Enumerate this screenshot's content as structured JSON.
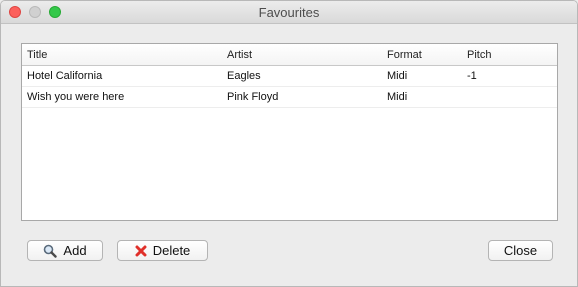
{
  "window": {
    "title": "Favourites"
  },
  "table": {
    "columns": [
      "Title",
      "Artist",
      "Format",
      "Pitch"
    ],
    "rows": [
      {
        "title": "Hotel California",
        "artist": "Eagles",
        "format": "Midi",
        "pitch": "-1"
      },
      {
        "title": "Wish you were here",
        "artist": "Pink Floyd",
        "format": "Midi",
        "pitch": ""
      }
    ]
  },
  "buttons": {
    "add": {
      "label": "Add",
      "icon": "magnifier-icon"
    },
    "delete": {
      "label": "Delete",
      "icon": "red-x-icon"
    },
    "close": {
      "label": "Close"
    }
  },
  "colors": {
    "close_light": "#fc605c",
    "zoom_light": "#34c84a",
    "delete_icon": "#e0302a"
  }
}
